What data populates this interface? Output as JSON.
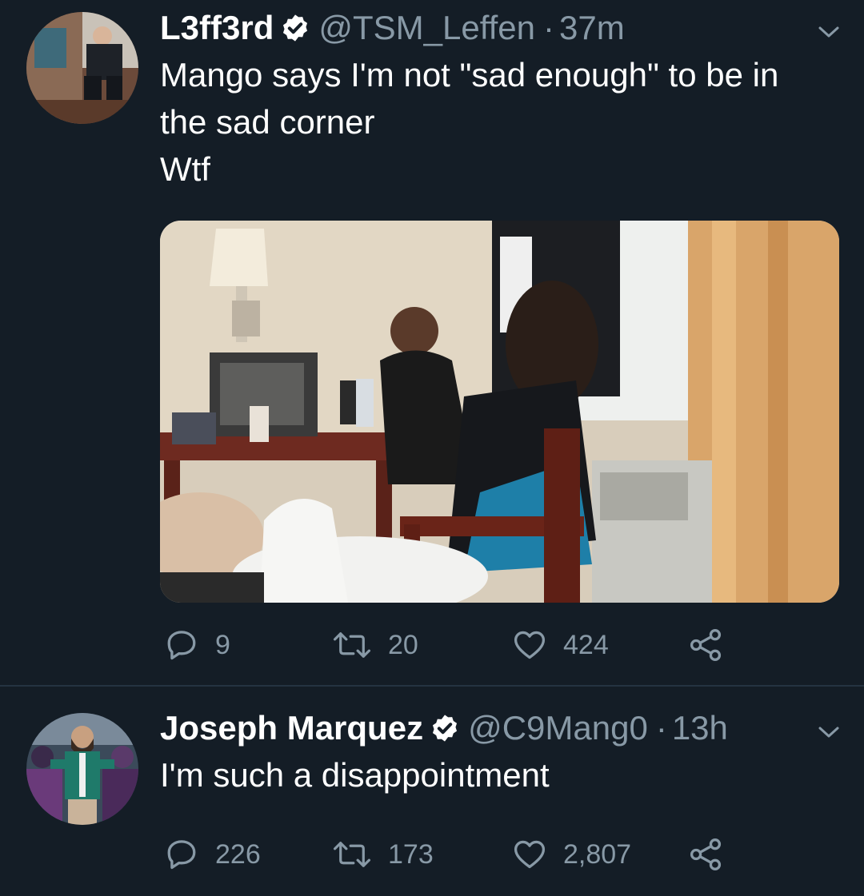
{
  "tweets": [
    {
      "name": "L3ff3rd",
      "handle": "@TSM_Leffen",
      "separator": "·",
      "time": "37m",
      "text": "Mango says I'm not \"sad enough\" to be in\nthe sad corner\nWtf",
      "replies": "9",
      "retweets": "20",
      "likes": "424"
    },
    {
      "name": "Joseph Marquez",
      "handle": "@C9Mang0",
      "separator": "·",
      "time": "13h",
      "text": "I'm such a disappointment",
      "replies": "226",
      "retweets": "173",
      "likes": "2,807"
    }
  ],
  "icons": {
    "verified": "verified-badge-icon",
    "caret": "chevron-down-icon",
    "reply": "reply-icon",
    "retweet": "retweet-icon",
    "like": "heart-icon",
    "share": "share-icon"
  },
  "colors": {
    "background": "#141d26",
    "text": "#ffffff",
    "secondary": "#8899a6",
    "divider": "#253341"
  }
}
